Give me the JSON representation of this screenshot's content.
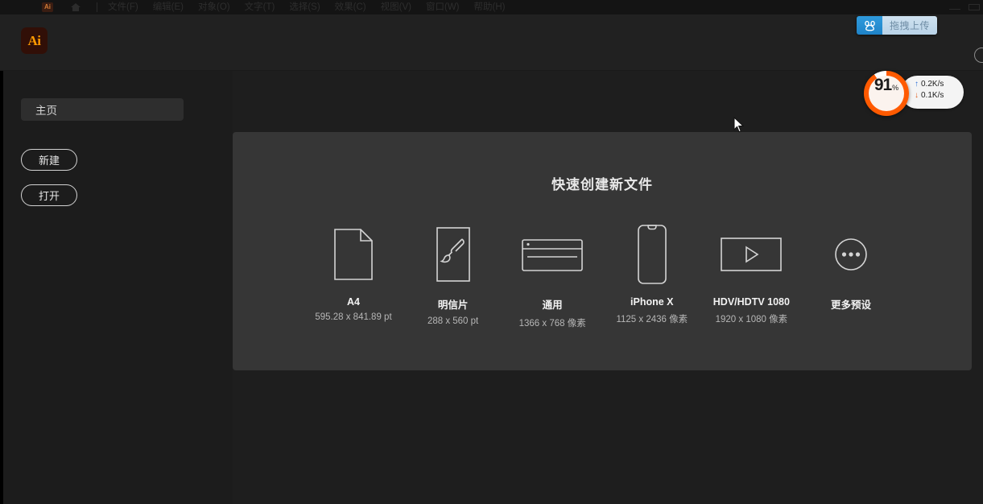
{
  "window": {
    "app_name": "Ai",
    "mini_logo_text": "Ai",
    "minimize_label": "—",
    "maximize_label": "□"
  },
  "menubar": {
    "items": [
      {
        "label": "文件(F)"
      },
      {
        "label": "编辑(E)"
      },
      {
        "label": "对象(O)"
      },
      {
        "label": "文字(T)"
      },
      {
        "label": "选择(S)"
      },
      {
        "label": "效果(C)"
      },
      {
        "label": "视图(V)"
      },
      {
        "label": "窗口(W)"
      },
      {
        "label": "帮助(H)"
      }
    ]
  },
  "baidu_upload": {
    "label": "拖拽上传",
    "icon": "baidu-cloud-icon",
    "icon_bg": "#2f9bdd",
    "text_bg": "#c5dcee"
  },
  "sidebar": {
    "tab_home": "主页",
    "buttons": [
      {
        "label": "新建",
        "name": "new-button"
      },
      {
        "label": "打开",
        "name": "open-button"
      }
    ]
  },
  "main": {
    "title": "快速创建新文件",
    "presets": [
      {
        "name": "A4",
        "dimensions": "595.28 x 841.89 pt",
        "icon": "document-page-icon"
      },
      {
        "name": "明信片",
        "dimensions": "288 x 560 pt",
        "icon": "paintbrush-icon"
      },
      {
        "name": "通用",
        "dimensions": "1366 x 768 像素",
        "icon": "browser-window-icon"
      },
      {
        "name": "iPhone X",
        "dimensions": "1125 x 2436 像素",
        "icon": "phone-icon"
      },
      {
        "name": "HDV/HDTV 1080",
        "dimensions": "1920 x 1080 像素",
        "icon": "video-play-icon"
      },
      {
        "name": "更多预设",
        "dimensions": "",
        "icon": "more-ellipsis-icon"
      }
    ]
  },
  "system_monitor": {
    "percent": "91",
    "percent_unit": "%",
    "upload_rate": "0.2K/s",
    "download_rate": "0.1K/s",
    "upload_arrow": "↑",
    "download_arrow": "↓",
    "ring_color": "#ff5a00",
    "upload_color": "#2d6fd8",
    "download_color": "#e05a19"
  },
  "colors": {
    "app_bg": "#1e1e1e",
    "panel_bg": "#363636",
    "sidebar_bg": "#1c1c1c",
    "accent_orange": "#ff9a00"
  }
}
